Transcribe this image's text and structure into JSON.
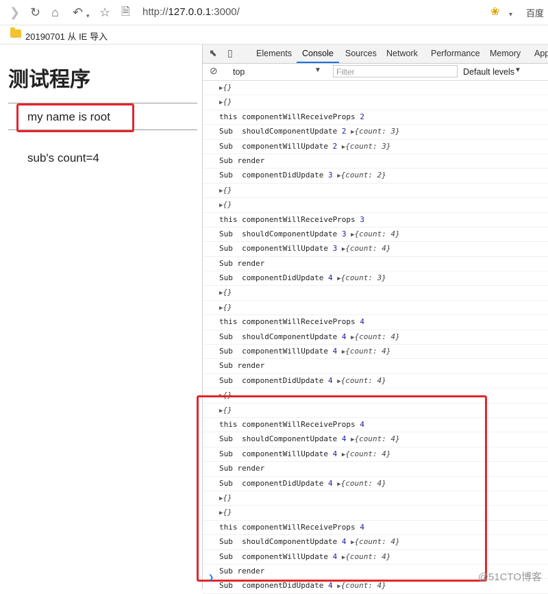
{
  "browser": {
    "url_scheme": "http://",
    "url_host": "127.0.0.1",
    "url_port": ":3000/",
    "search_engine": "百度",
    "bookmark_label": "20190701 从 IE 导入"
  },
  "page": {
    "title": "测试程序",
    "name_text": "my  name is  root",
    "count_text": "sub's count=4"
  },
  "devtools": {
    "tabs": [
      "Elements",
      "Console",
      "Sources",
      "Network",
      "Performance",
      "Memory",
      "App"
    ],
    "context": "top",
    "filter_placeholder": "Filter",
    "levels": "Default levels"
  },
  "console_rows": [
    {
      "type": "obj",
      "text": "{}"
    },
    {
      "type": "obj",
      "text": "{}"
    },
    {
      "type": "log",
      "text": "this componentWillReceiveProps ",
      "num": "2"
    },
    {
      "type": "logobj",
      "text": "Sub  shouldComponentUpdate ",
      "num": "2",
      "obj": "{count: 3}"
    },
    {
      "type": "logobj",
      "text": "Sub  componentWillUpdate ",
      "num": "2",
      "obj": "{count: 3}"
    },
    {
      "type": "log",
      "text": "Sub render",
      "num": ""
    },
    {
      "type": "logobj",
      "text": "Sub  componentDidUpdate ",
      "num": "3",
      "obj": "{count: 2}"
    },
    {
      "type": "obj",
      "text": "{}"
    },
    {
      "type": "obj",
      "text": "{}"
    },
    {
      "type": "log",
      "text": "this componentWillReceiveProps ",
      "num": "3"
    },
    {
      "type": "logobj",
      "text": "Sub  shouldComponentUpdate ",
      "num": "3",
      "obj": "{count: 4}"
    },
    {
      "type": "logobj",
      "text": "Sub  componentWillUpdate ",
      "num": "3",
      "obj": "{count: 4}"
    },
    {
      "type": "log",
      "text": "Sub render",
      "num": ""
    },
    {
      "type": "logobj",
      "text": "Sub  componentDidUpdate ",
      "num": "4",
      "obj": "{count: 3}"
    },
    {
      "type": "obj",
      "text": "{}"
    },
    {
      "type": "obj",
      "text": "{}"
    },
    {
      "type": "log",
      "text": "this componentWillReceiveProps ",
      "num": "4"
    },
    {
      "type": "logobj",
      "text": "Sub  shouldComponentUpdate ",
      "num": "4",
      "obj": "{count: 4}"
    },
    {
      "type": "logobj",
      "text": "Sub  componentWillUpdate ",
      "num": "4",
      "obj": "{count: 4}"
    },
    {
      "type": "log",
      "text": "Sub render",
      "num": ""
    },
    {
      "type": "logobj",
      "text": "Sub  componentDidUpdate ",
      "num": "4",
      "obj": "{count: 4}"
    },
    {
      "type": "obj",
      "text": "{}"
    },
    {
      "type": "obj",
      "text": "{}"
    },
    {
      "type": "log",
      "text": "this componentWillReceiveProps ",
      "num": "4"
    },
    {
      "type": "logobj",
      "text": "Sub  shouldComponentUpdate ",
      "num": "4",
      "obj": "{count: 4}"
    },
    {
      "type": "logobj",
      "text": "Sub  componentWillUpdate ",
      "num": "4",
      "obj": "{count: 4}"
    },
    {
      "type": "log",
      "text": "Sub render",
      "num": ""
    },
    {
      "type": "logobj",
      "text": "Sub  componentDidUpdate ",
      "num": "4",
      "obj": "{count: 4}"
    },
    {
      "type": "obj",
      "text": "{}"
    },
    {
      "type": "obj",
      "text": "{}"
    },
    {
      "type": "log",
      "text": "this componentWillReceiveProps ",
      "num": "4"
    },
    {
      "type": "logobj",
      "text": "Sub  shouldComponentUpdate ",
      "num": "4",
      "obj": "{count: 4}"
    },
    {
      "type": "logobj",
      "text": "Sub  componentWillUpdate ",
      "num": "4",
      "obj": "{count: 4}"
    },
    {
      "type": "log",
      "text": "Sub render",
      "num": ""
    },
    {
      "type": "logobj",
      "text": "Sub  componentDidUpdate ",
      "num": "4",
      "obj": "{count: 4}"
    }
  ],
  "watermark": "@51CTO博客",
  "colors": {
    "highlight": "#e3262a",
    "number": "#1a1aa6",
    "tab_accent": "#1a73e8"
  }
}
